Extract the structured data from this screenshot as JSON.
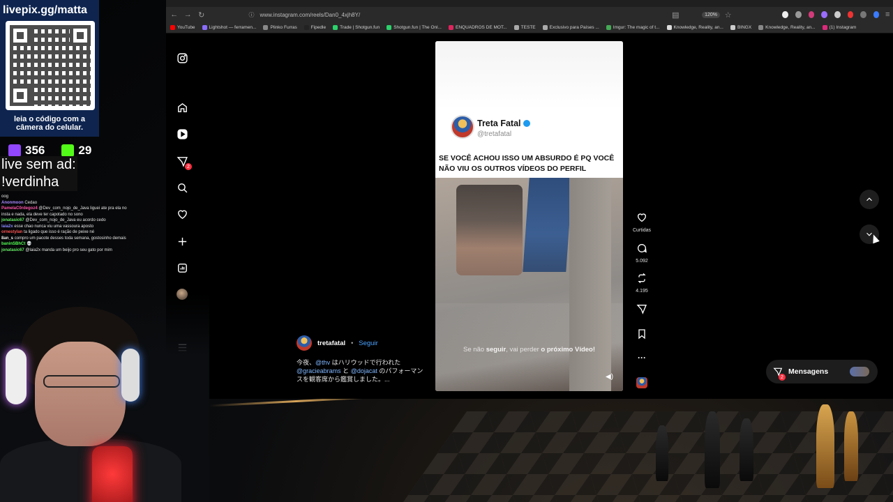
{
  "browser": {
    "url": "www.instagram.com/reels/Dan0_4xjh8Y/",
    "zoom": "120%",
    "bookmarks": [
      "YouTube",
      "Lightshot — ferramen...",
      "Plinko Furras",
      "Fipedle",
      "Trade | Shotgun.fun",
      "Shotgun.fun | The Onl...",
      "ENQUADROS DE MOT...",
      "TESTE",
      "Exclusivo para Países ...",
      "Imgur: The magic of t...",
      "Knowledge, Reality, an...",
      "BINGX",
      "Knowledge, Reality, an...",
      "(1) Instagram"
    ],
    "bookmark_colors": [
      "#ff0000",
      "#8a6cff",
      "#888888",
      "#222222",
      "#2bd26b",
      "#2bd26b",
      "#e0245e",
      "#aaaaaa",
      "#aaaaaa",
      "#44aa55",
      "#dddddd",
      "#cccccc",
      "#888888",
      "#dd2a7b"
    ]
  },
  "instagram": {
    "sidebar": {
      "icons": [
        "instagram-icon",
        "home-icon",
        "reels-icon",
        "messages-icon",
        "search-icon",
        "heart-icon",
        "create-icon",
        "dashboard-icon",
        "profile-icon",
        "menu-icon",
        "more-apps-icon"
      ],
      "messages_badge": "2"
    },
    "reel": {
      "name": "Treta Fatal",
      "handle": "@tretafatal",
      "caption": "SE VOCÊ ACHOU ISSO UM ABSURDO É PQ VOCÊ NÃO VIU OS OUTROS VÍDEOS DO PERFIL",
      "overlay_prefix": "Se não ",
      "overlay_bold": "seguir",
      "overlay_mid": ", vai perder ",
      "overlay_bold2": "o próximo Vídeo!"
    },
    "actions": {
      "likes_label": "Curtidas",
      "comments": "5.092",
      "reposts": "4.195"
    },
    "post": {
      "username": "tretafatal",
      "follow": "Seguir",
      "desc_1": "今夜、",
      "tag_1": "@thv",
      "desc_2": " はハリウッドで行われた ",
      "tag_2": "@gracieabrams",
      "desc_3": " と ",
      "tag_3": "@dojacat",
      "desc_4": " のパフォーマンスを観客席から鑑賞しました。..."
    },
    "messages": {
      "label": "Mensagens",
      "badge": "2"
    }
  },
  "stream": {
    "url": "livepix.gg/matta",
    "qr_caption": "leia o código com a câmera do celular.",
    "viewers_twitch": "356",
    "viewers_kick": "29",
    "ad_line1": "live sem ad:",
    "ad_line2": "!verdinha",
    "chat": [
      {
        "user": "",
        "msg": "oog",
        "color": "#dddddd"
      },
      {
        "user": "Anonmoon",
        "msg": "Cedao",
        "color": "#aa88ff"
      },
      {
        "user": "PamelaC0rdegoz4",
        "msg": "@Dev_com_nojo_de_Java liguei ate pra ela no insta e nada, ela deve ter capotado no sono",
        "color": "#ff55aa"
      },
      {
        "user": "jonatasic67",
        "msg": "@Dev_com_nojo_de_Java eu acordo cedo",
        "color": "#66ee66"
      },
      {
        "user": "laia2x",
        "msg": "esse chao nunca viu uma vassoura aposto",
        "color": "#8888ff"
      },
      {
        "user": "ornestylan",
        "msg": "ta ligado que isso é ração de peixe né",
        "color": "#ff5555"
      },
      {
        "user": "8an_s",
        "msg": "compro um pacote desses toda semana, gostosinho demais",
        "color": "#eeeeee"
      },
      {
        "user": "baninSBhCt",
        "msg": "💀",
        "color": "#55ff55"
      },
      {
        "user": "jonatasic67",
        "msg": "@laia2x manda um beijo pro seu gato por mim",
        "color": "#66ee66"
      }
    ]
  }
}
